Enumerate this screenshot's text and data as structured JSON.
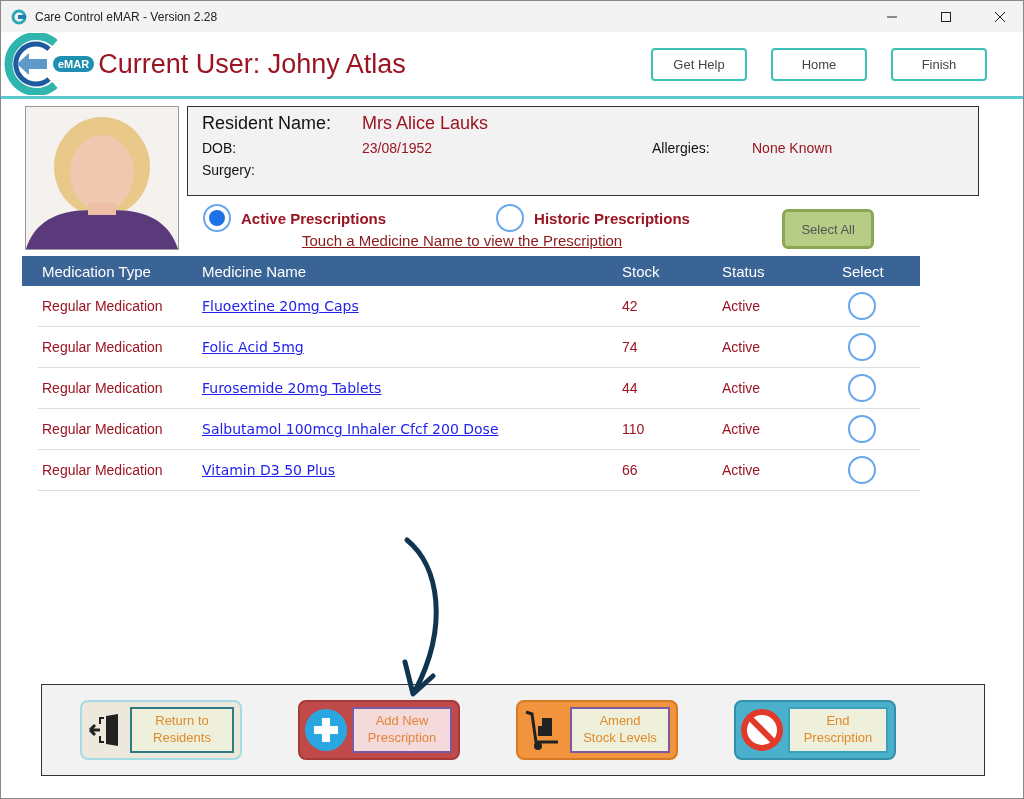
{
  "window": {
    "title": "Care Control eMAR - Version 2.28"
  },
  "header": {
    "logo_badge": "eMAR",
    "current_user": "Current User: Johny Atlas",
    "buttons": [
      "Get Help",
      "Home",
      "Finish"
    ]
  },
  "resident": {
    "name_label": "Resident Name:",
    "name": "Mrs Alice Lauks",
    "dob_label": "DOB:",
    "dob": "23/08/1952",
    "allergies_label": "Allergies:",
    "allergies": "None Known",
    "surgery_label": "Surgery:"
  },
  "filters": [
    {
      "label": "Active Prescriptions",
      "selected": true
    },
    {
      "label": "Historic Prescriptions",
      "selected": false
    }
  ],
  "hint": "Touch a Medicine Name to view the Prescription",
  "select_all": "Select All",
  "table": {
    "columns": [
      "Medication Type",
      "Medicine Name",
      "Stock",
      "Status",
      "Select"
    ],
    "rows": [
      {
        "type": "Regular Medication",
        "medicine": "Fluoextine 20mg Caps",
        "stock": "42",
        "status": "Active",
        "selected": false
      },
      {
        "type": "Regular Medication",
        "medicine": "Folic Acid 5mg",
        "stock": "74",
        "status": "Active",
        "selected": false
      },
      {
        "type": "Regular Medication",
        "medicine": "Furosemide 20mg Tablets",
        "stock": "44",
        "status": "Active",
        "selected": false
      },
      {
        "type": "Regular Medication",
        "medicine": "Salbutamol 100mcg Inhaler Cfcf 200 Dose",
        "stock": "110",
        "status": "Active",
        "selected": false
      },
      {
        "type": "Regular Medication",
        "medicine": "Vitamin D3 50 Plus",
        "stock": "66",
        "status": "Active",
        "selected": false
      }
    ]
  },
  "actions": [
    {
      "kind": "exit",
      "label": "Return to Residents"
    },
    {
      "kind": "add",
      "label": "Add New Prescription"
    },
    {
      "kind": "stock",
      "label": "Amend Stock Levels"
    },
    {
      "kind": "end",
      "label": "End Prescription"
    }
  ]
}
